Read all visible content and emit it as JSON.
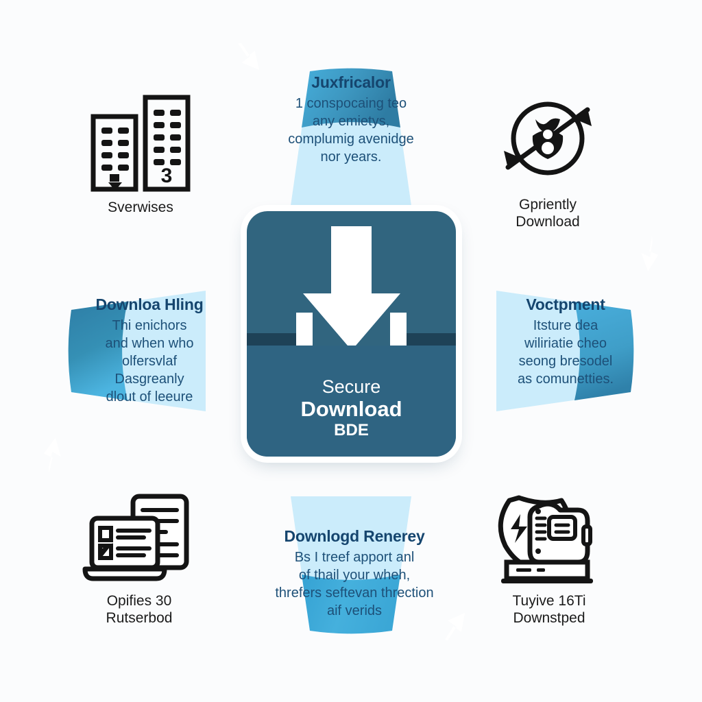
{
  "diagram": {
    "type": "radial-wedge-infographic",
    "background_color": "#fbfcfd",
    "colors": {
      "wedge_fill": "#cbecfb",
      "arc_band_top": "#3d96bf",
      "arc_band_left": "#3590b5",
      "arc_band_right": "#3f9ec8",
      "arc_band_bottom": "#45b0dd",
      "center_card": "#31657f",
      "center_card_shadow": "#1e4257",
      "heading_text": "#15456e",
      "body_text": "#1d5078",
      "arrow_marker": "#ffffff",
      "icon_stroke": "#141414",
      "label_text": "#1b1b1b"
    },
    "center": {
      "icon": "download-to-tray-icon",
      "line1": "Secure",
      "line2": "Download",
      "line3": "BDE"
    },
    "wedges": [
      {
        "position": "top",
        "title": "Juxfricalor",
        "body": "1 conspocaing teo any emietys, complumig avenidge nor years.",
        "lines": [
          "1 conspocaing teo",
          "any emietys,",
          "complumig avenidge",
          "nor years."
        ],
        "arrow": "arrow-down-left-icon"
      },
      {
        "position": "right",
        "title": "Voctpment",
        "body": "Itsture dea wiliriatie cheo seong bresodel as comunetties.",
        "lines": [
          "Itsture dea",
          "wiliriatie cheo",
          "seong bresodel",
          "as comunetties."
        ],
        "arrow": "arrow-down-icon"
      },
      {
        "position": "bottom",
        "title": "Downlogd Renerey",
        "body": "Bs I treef apport anl of thail your wheh, threfers seftevan threction aif verids",
        "lines": [
          "Bs I treef apport anl",
          "of thail your wheh,",
          "threfers seftevan threction",
          "aif verids"
        ],
        "arrow": "arrow-up-icon"
      },
      {
        "position": "left",
        "title": "Downloa Hling",
        "body": "Thi enichors and when who olfersvlaf Dasgreanly dlout of leeure",
        "lines": [
          "Thi enichors",
          "and when who",
          "olfersvlaf",
          "Dasgreanly",
          "dlout of leeure"
        ],
        "arrow": "arrow-up-left-icon"
      }
    ],
    "corners": [
      {
        "position": "top-left",
        "icon": "office-buildings-icon",
        "label_lines": [
          "Sverwises"
        ]
      },
      {
        "position": "top-right",
        "icon": "circular-transfer-arrow-icon",
        "label_lines": [
          "Gpriently",
          "Download"
        ]
      },
      {
        "position": "bottom-left",
        "icon": "laptop-document-checklist-icon",
        "label_lines": [
          "Opifies 30",
          "Rutserbod"
        ]
      },
      {
        "position": "bottom-right",
        "icon": "shield-bolt-server-icon",
        "label_lines": [
          "Tuyive 16Ti",
          "Downstped"
        ]
      }
    ]
  }
}
